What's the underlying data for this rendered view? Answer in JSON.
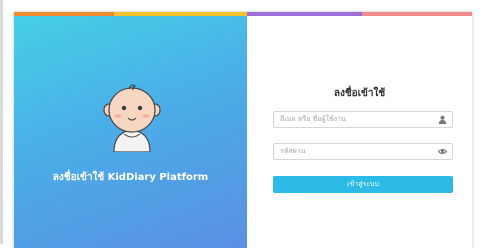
{
  "hero": {
    "title": "ลงชื่อเข้าใช้ KidDiary Platform"
  },
  "form": {
    "title": "ลงชื่อเข้าใช้",
    "email_placeholder": "อีเมล หรือ ชื่อผู้ใช้งาน",
    "password_placeholder": "รหัสผ่าน",
    "submit_label": "เข้าสู่ระบบ"
  },
  "icons": {
    "email_field": "user-icon",
    "password_field": "eye-icon",
    "hero": "baby-face-icon"
  },
  "colors": {
    "accent": "#2bbbe6",
    "hero_gradient_start": "#45d0e6",
    "hero_gradient_end": "#5a8fe3",
    "topbar": [
      "#ef8a2e",
      "#f2c22b",
      "#9b6fd6",
      "#f08b8b"
    ]
  }
}
